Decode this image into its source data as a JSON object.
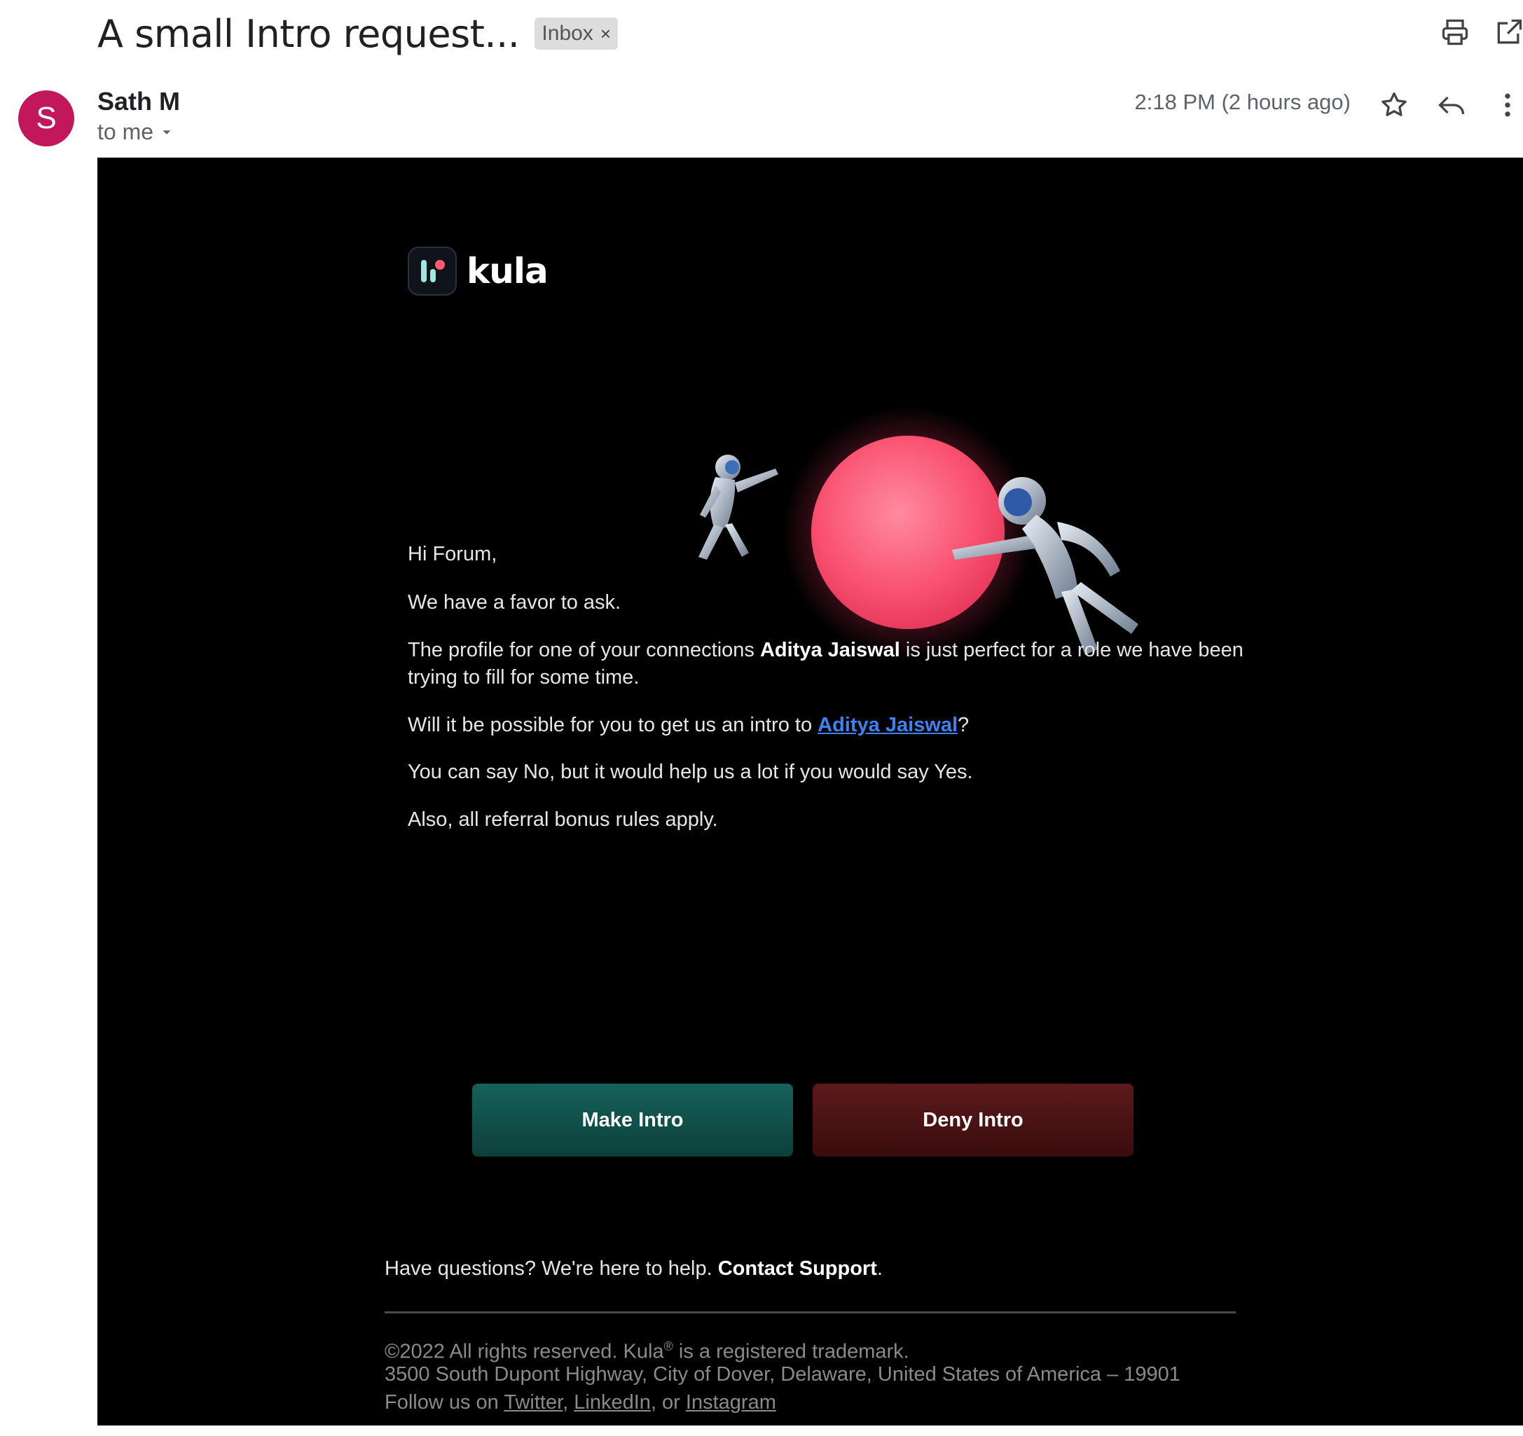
{
  "subject": "A small Intro request...",
  "label_chip": {
    "text": "Inbox",
    "close": "×"
  },
  "sender": {
    "name": "Sath M",
    "initial": "S",
    "recipient": "to me"
  },
  "timestamp": "2:18 PM (2 hours ago)",
  "icons": [
    "print-icon",
    "open-in-new-window-icon",
    "star-icon",
    "reply-icon",
    "more-vert-icon",
    "chevron-down-icon"
  ],
  "email": {
    "brand": "kula",
    "greeting": "Hi Forum,",
    "line1": "We have a favor to ask.",
    "line2_pre": "The profile for one of your connections ",
    "line2_name": "Aditya Jaiswal",
    "line2_post": " is just perfect for a role we have been trying to fill for some time.",
    "line3_pre": "Will it be possible for you to get us an intro to ",
    "line3_link": "Aditya Jaiswal",
    "line3_post": "?",
    "line4": "You can say No, but it would help us a lot if you would say Yes.",
    "line5": "Also, all referral bonus rules apply.",
    "make_intro": "Make Intro",
    "deny_intro": "Deny Intro",
    "help_text": "Have questions? We're here to help. ",
    "contact_support": "Contact Support",
    "help_end": ".",
    "copyright_pre": "©2022 All rights reserved. Kula",
    "registered": "®",
    "copyright_post": " is a registered trademark.",
    "address": "3500 South Dupont Highway, City of Dover, Delaware, United States of America – 19901",
    "follow_pre": "Follow us on ",
    "twitter": "Twitter",
    "sep1": ", ",
    "linkedin": "LinkedIn",
    "sep2": ", or ",
    "instagram": "Instagram"
  },
  "colors": {
    "avatar": "#c2185b",
    "make_button": "#15625a",
    "deny_button": "#5c1a1c",
    "planet": "#ff5f7e",
    "link": "#3d82f2"
  }
}
